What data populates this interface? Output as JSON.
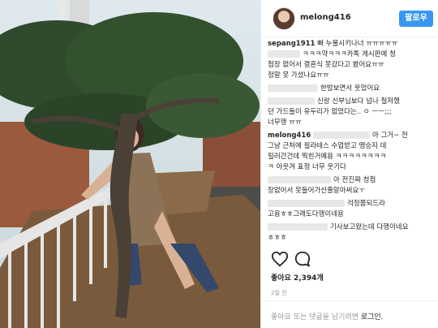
{
  "header": {
    "username": "melong416",
    "follow_label": "팔로우"
  },
  "comments": [
    {
      "user": "sepang1911",
      "text": "빠 누물시키나너 ㅠㅠㅠㅠㅠ"
    },
    {
      "user": "",
      "text": "ㅋㅋㅋ약ㅋㅋㅋ카톡 게시판에 청"
    },
    {
      "user": "",
      "text": "첩장 없어서 결혼식 못갔다고 봤어요ㅠㅠ"
    },
    {
      "user": "",
      "text": "정말 못 가셨나요ㅠㅠ"
    },
    {
      "user": "",
      "text": "한밤보면서 웃었어요"
    },
    {
      "user": "",
      "text": "신랑 신부님보다 넘나 철저했"
    },
    {
      "user": "",
      "text": "던 가드들이 유두리가 없었다는.. ㅇ ㅡㅡ;;;"
    },
    {
      "user": "",
      "text": "너무행 ㅠㅠ"
    },
    {
      "user": "melong416",
      "text": "아 그거~ 전"
    },
    {
      "user": "",
      "text": "그냥 근처에 필라테스 수업받고 땡승지 데"
    },
    {
      "user": "",
      "text": "릴러간건데 찍힌거예용 ㅋㅋㅋㅋㅋㅋㅋㅋ"
    },
    {
      "user": "",
      "text": "ㅋ 아웃겨 표정 너무 웃기다"
    },
    {
      "user": "",
      "text": "아 전진짜 청첩"
    },
    {
      "user": "",
      "text": "장없어서 못들어가신줄알아써요ㅜ"
    },
    {
      "user": "",
      "text": "걱정쫌되드라"
    },
    {
      "user": "",
      "text": "고용ㅎㅎ그래도다행이네용"
    },
    {
      "user": "",
      "text": "기사보고왔는데 다행이네요"
    },
    {
      "user": "",
      "text": "ㅎㅎㅎ"
    }
  ],
  "actions": {
    "like_icon": "heart-icon",
    "comment_icon": "comment-icon"
  },
  "likes_label": "좋아요 2,394개",
  "time_label": "2일 전",
  "footer": {
    "prompt": "좋아요 또는 댓글을 남기려면 ",
    "login": "로그인."
  }
}
